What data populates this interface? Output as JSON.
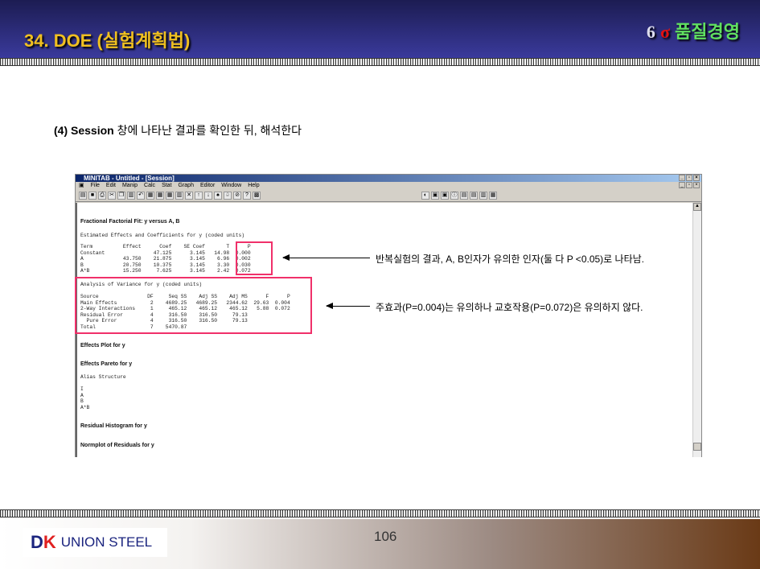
{
  "slide": {
    "title": "34. DOE (실험계획법)",
    "brand_six": "6",
    "brand_sigma": "σ",
    "brand_text": "품질경영",
    "step_num": "(4) Session",
    "step_text": "창에 나타난 결과를 확인한 뒤, 해석한다",
    "page": "106",
    "logo_mark_d": "D",
    "logo_mark_k": "K",
    "logo_name": "UNION STEEL"
  },
  "window": {
    "title": "MINITAB - Untitled - [Session]",
    "menu": [
      "File",
      "Edit",
      "Manip",
      "Calc",
      "Stat",
      "Graph",
      "Editor",
      "Window",
      "Help"
    ]
  },
  "session": {
    "heading": "Fractional Factorial Fit: y versus A, B",
    "effects_title": "Estimated Effects and Coefficients for y (coded units)",
    "effects_table": "Term          Effect      Coef    SE Coef       T      P\nConstant                47.125      3.145   14.98  0.000\nA             43.750    21.875      3.145    6.96  0.002\nB             20.750    10.375      3.145    3.30  0.030\nA*B           15.250     7.625      3.145    2.42  0.072",
    "anova_title": "Analysis of Variance for y (coded units)",
    "anova_table": "Source                DF     Seq SS    Adj SS    Adj MS      F      P\nMain Effects           2    4689.25   4689.25   2344.62  29.63  0.004\n2-Way Interactions     1     465.12    465.12    465.12   5.88  0.072\nResidual Error         4     316.50    316.50     79.13\n  Pure Error           4     316.50    316.50     79.13\nTotal                  7    5470.87",
    "effects_plot": "Effects Plot for y",
    "effects_pareto": "Effects Pareto for y",
    "alias_title": "Alias Structure",
    "alias_list": "I\nA\nB\nA*B",
    "residual_hist": "Residual Histogram for y",
    "normplot": "Normplot of Residuals for y"
  },
  "annotations": [
    "반복실험의 결과, A, B인자가 유의한 인자(둘 다 P <0.05)로 나타남.",
    "주효과(P=0.004)는 유의하나 교호작용(P=0.072)은 유의하지 않다."
  ]
}
